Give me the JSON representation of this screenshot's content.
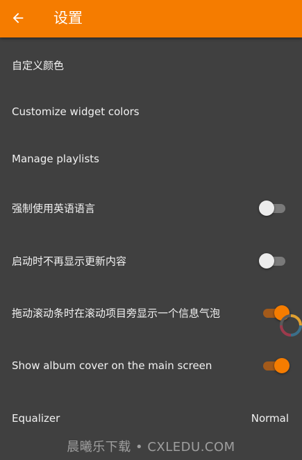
{
  "appbar": {
    "title": "设置",
    "back_icon": "arrow-left-icon",
    "color": "#f57c00"
  },
  "settings": {
    "custom_color": {
      "label": "自定义颜色"
    },
    "widget_colors": {
      "label": "Customize widget colors"
    },
    "playlists": {
      "label": "Manage playlists"
    },
    "force_english": {
      "label": "强制使用英语语言",
      "enabled": false
    },
    "no_changelog": {
      "label": "启动时不再显示更新内容",
      "enabled": false
    },
    "scroll_bubble": {
      "label": "拖动滚动条时在滚动项目旁显示一个信息气泡",
      "enabled": true
    },
    "album_cover": {
      "label": "Show album cover on the main screen",
      "enabled": true
    },
    "equalizer": {
      "label": "Equalizer",
      "value": "Normal"
    }
  },
  "theme": {
    "background": "#404040",
    "accent": "#f57c00"
  },
  "watermark": "晨曦乐下载 • CXLEDU.COM"
}
